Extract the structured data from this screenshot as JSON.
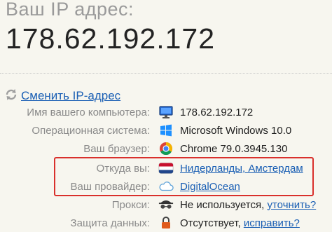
{
  "header": {
    "title": "Ваш IP адрес:",
    "ip": "178.62.192.172"
  },
  "change_ip": {
    "label": "Сменить IP-адрес"
  },
  "rows": [
    {
      "label": "Имя вашего компьютера:",
      "value": "178.62.192.172",
      "icon": "monitor-icon"
    },
    {
      "label": "Операционная система:",
      "value": "Microsoft Windows 10.0",
      "icon": "windows-logo-icon"
    },
    {
      "label": "Ваш браузер:",
      "value": "Chrome 79.0.3945.130",
      "icon": "chrome-logo-icon"
    },
    {
      "label": "Откуда вы:",
      "value": "Нидерланды, Амстердам",
      "icon": "netherlands-flag-icon"
    },
    {
      "label": "Ваш провайдер:",
      "value": "DigitalOcean",
      "icon": "cloud-icon"
    },
    {
      "label": "Прокси:",
      "value": "Не используется,",
      "extra": "уточнить?",
      "icon": "spy-glasses-icon"
    },
    {
      "label": "Защита данных:",
      "value": "Отсутствует,",
      "extra": "исправить?",
      "icon": "lock-icon"
    }
  ],
  "colors": {
    "background": "#f7f6ef",
    "link": "#1a5fb4",
    "highlight_border": "#d9302c",
    "label": "#8a8a8a"
  }
}
